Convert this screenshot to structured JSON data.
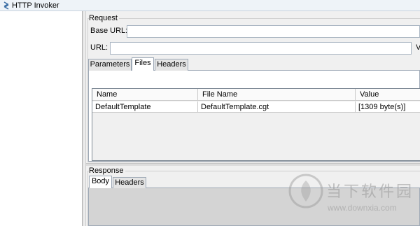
{
  "window": {
    "title": "HTTP Invoker"
  },
  "request": {
    "group_label": "Request",
    "base_url_label": "Base URL:",
    "base_url_value": "",
    "url_label": "URL:",
    "url_value": "",
    "clipped_label": "V",
    "tabs": [
      {
        "label": "Parameters",
        "active": false
      },
      {
        "label": "Files",
        "active": true
      },
      {
        "label": "Headers",
        "active": false
      }
    ],
    "files_table": {
      "columns": [
        "Name",
        "File Name",
        "Value"
      ],
      "rows": [
        [
          "DefaultTemplate",
          "DefaultTemplate.cgt",
          "[1309 byte(s)]"
        ]
      ]
    }
  },
  "response": {
    "group_label": "Response",
    "tabs": [
      {
        "label": "Body",
        "active": true
      },
      {
        "label": "Headers",
        "active": false
      }
    ]
  },
  "watermark": {
    "logo_icon": "downxia-logo-icon",
    "brand_cn": "当下软件园",
    "url": "www.downxia.com"
  }
}
